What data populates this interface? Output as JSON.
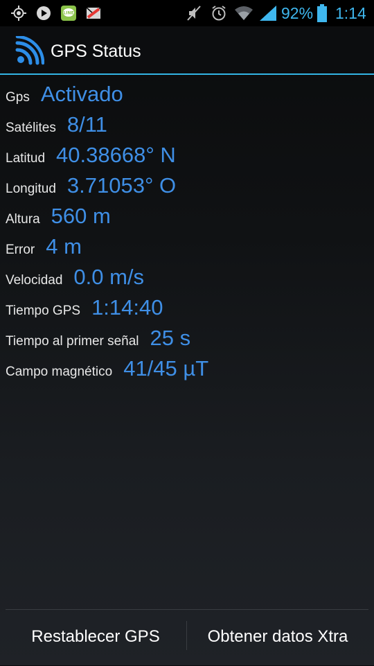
{
  "status_bar": {
    "battery_percent": "92%",
    "time": "1:14",
    "icons": [
      "gps-icon",
      "app-notification-icon",
      "line-icon",
      "mail-icon",
      "mute-icon",
      "alarm-icon",
      "wifi-icon",
      "signal-icon",
      "battery-icon"
    ],
    "accent_color": "#3fb7ee"
  },
  "action_bar": {
    "title": "GPS Status",
    "divider_color": "#33b5e5"
  },
  "rows": [
    {
      "label": "Gps",
      "value": "Activado"
    },
    {
      "label": "Satélites",
      "value": "8/11"
    },
    {
      "label": "Latitud",
      "value": "40.38668° N"
    },
    {
      "label": "Longitud",
      "value": "3.71053° O"
    },
    {
      "label": "Altura",
      "value": "560 m"
    },
    {
      "label": "Error",
      "value": "4 m"
    },
    {
      "label": "Velocidad",
      "value": "0.0 m/s"
    },
    {
      "label": "Tiempo GPS",
      "value": "1:14:40"
    },
    {
      "label": "Tiempo al primer señal",
      "value": "25 s"
    },
    {
      "label": "Campo magnético",
      "value": "41/45 µT"
    }
  ],
  "buttons": {
    "reset": "Restablecer GPS",
    "xtra": "Obtener datos Xtra"
  },
  "colors": {
    "value_text": "#3f8fe6",
    "label_text": "#e8e8e8"
  }
}
